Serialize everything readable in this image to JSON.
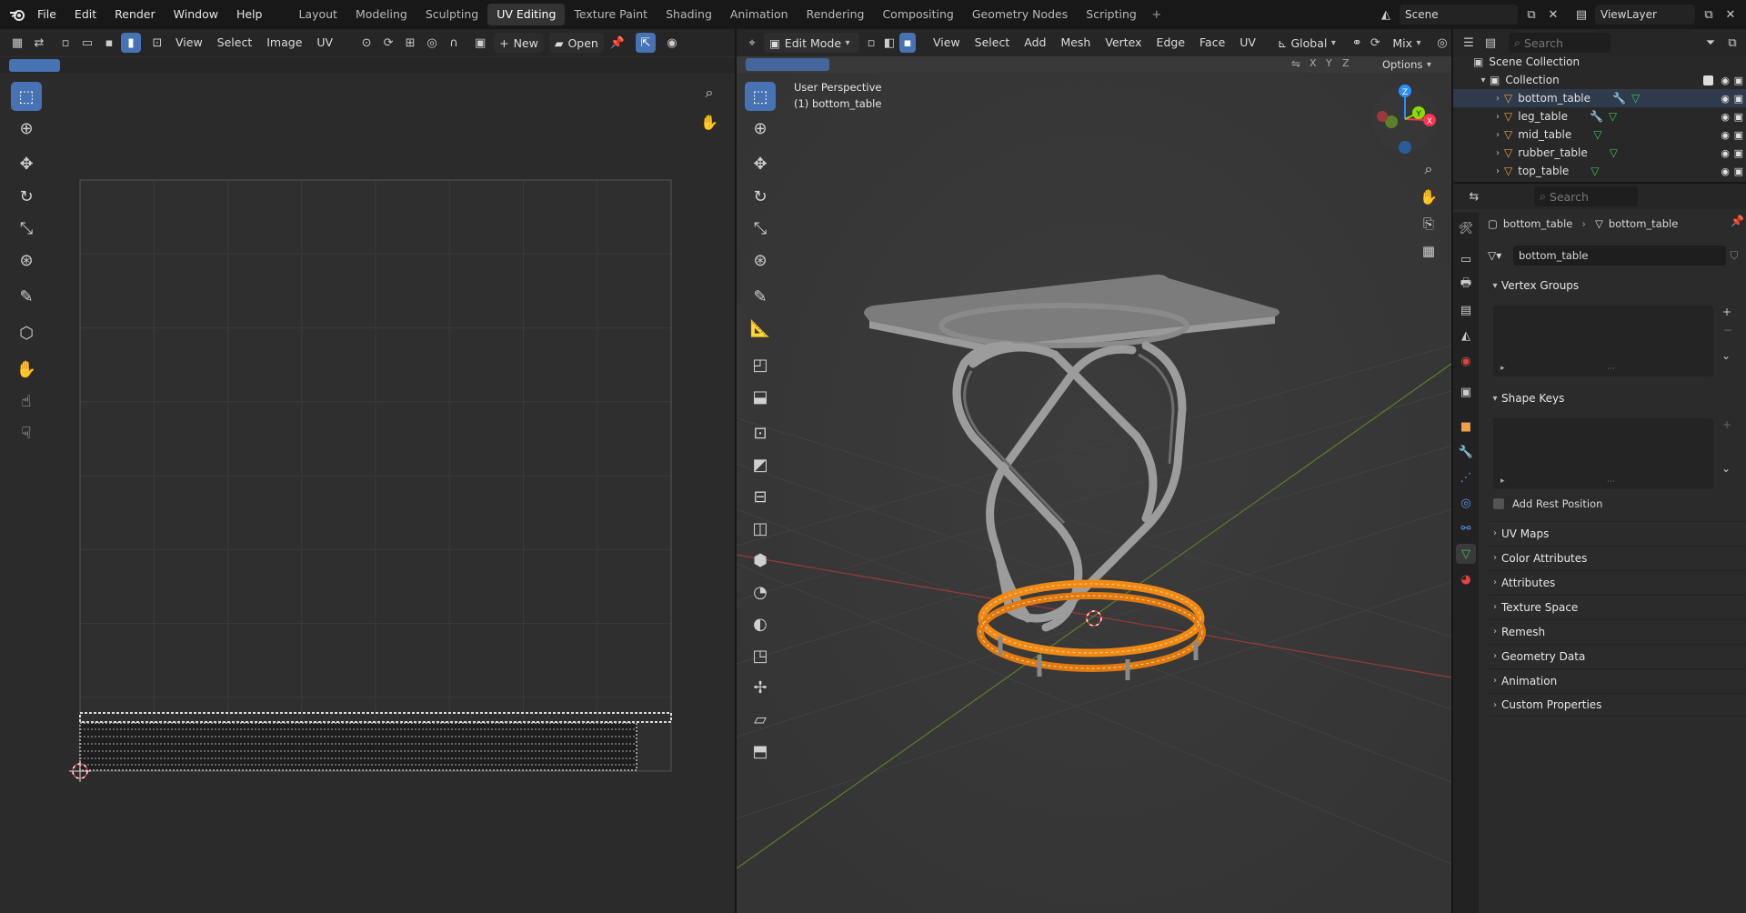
{
  "menu": {
    "file": "File",
    "edit": "Edit",
    "render": "Render",
    "window": "Window",
    "help": "Help"
  },
  "workspaces": [
    "Layout",
    "Modeling",
    "Sculpting",
    "UV Editing",
    "Texture Paint",
    "Shading",
    "Animation",
    "Rendering",
    "Compositing",
    "Geometry Nodes",
    "Scripting"
  ],
  "active_workspace": "UV Editing",
  "scene": "Scene",
  "view_layer": "ViewLayer",
  "uv_editor": {
    "menus": [
      "View",
      "Select",
      "Image",
      "UV"
    ],
    "new_label": "New",
    "open_label": "Open"
  },
  "viewport": {
    "mode": "Edit Mode",
    "menus": [
      "View",
      "Select",
      "Add",
      "Mesh",
      "Vertex",
      "Edge",
      "Face",
      "UV"
    ],
    "orientation": "Global",
    "mix": "Mix",
    "perspective_label": "User Perspective",
    "object_label": "(1) bottom_table",
    "axes": [
      "X",
      "Y",
      "Z"
    ],
    "options": "Options"
  },
  "outliner": {
    "search_placeholder": "Search",
    "scene_collection": "Scene Collection",
    "collection": "Collection",
    "objects": [
      "bottom_table",
      "leg_table",
      "mid_table",
      "rubber_table",
      "top_table"
    ]
  },
  "properties": {
    "search_placeholder": "Search",
    "breadcrumb_object": "bottom_table",
    "breadcrumb_mesh": "bottom_table",
    "mesh_name": "bottom_table",
    "vertex_groups": "Vertex Groups",
    "shape_keys": "Shape Keys",
    "add_rest_position": "Add Rest Position",
    "sections": [
      "UV Maps",
      "Color Attributes",
      "Attributes",
      "Texture Space",
      "Remesh",
      "Geometry Data",
      "Animation",
      "Custom Properties"
    ]
  },
  "colors": {
    "accent": "#4772b3",
    "selection": "#ff8c00",
    "x_axis": "#ff3352",
    "y_axis": "#8bdc00",
    "z_axis": "#2c8fff"
  }
}
